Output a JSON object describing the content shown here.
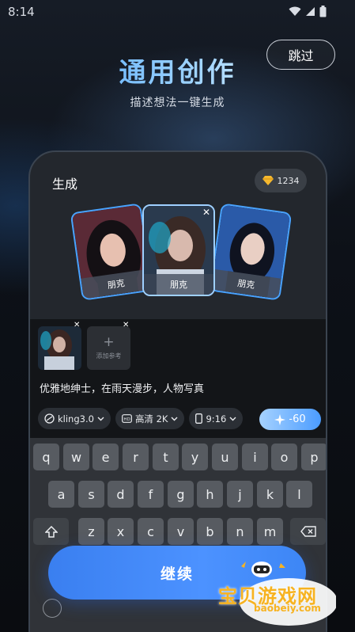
{
  "status_bar": {
    "time": "8:14"
  },
  "header": {
    "skip_label": "跳过",
    "title": "通用创作",
    "subtitle": "描述想法一键生成"
  },
  "generate": {
    "section_label": "生成",
    "credits": "1234",
    "style_cards": [
      {
        "label": "朋克"
      },
      {
        "label": "朋克"
      },
      {
        "label": "朋克"
      }
    ],
    "add_reference_label": "添加参考",
    "prompt": "优雅地绅士，在雨天漫步，人物写真",
    "options": [
      {
        "label": "kling3.0"
      },
      {
        "label": "高清 2K"
      },
      {
        "label": "9:16"
      }
    ],
    "cost_label": "-60"
  },
  "keyboard": {
    "row1": [
      "q",
      "w",
      "e",
      "r",
      "t",
      "y",
      "u",
      "i",
      "o",
      "p"
    ],
    "row2": [
      "a",
      "s",
      "d",
      "f",
      "g",
      "h",
      "j",
      "k",
      "l"
    ],
    "row3": [
      "z",
      "x",
      "c",
      "v",
      "b",
      "n",
      "m"
    ]
  },
  "continue_label": "继续",
  "watermark": {
    "brand": "宝贝游戏网",
    "url": "baobeiy.com"
  },
  "colors": {
    "accent": "#4b92ff",
    "card_border": "#49a3ff",
    "title_gradient_start": "#5fb0ff"
  }
}
